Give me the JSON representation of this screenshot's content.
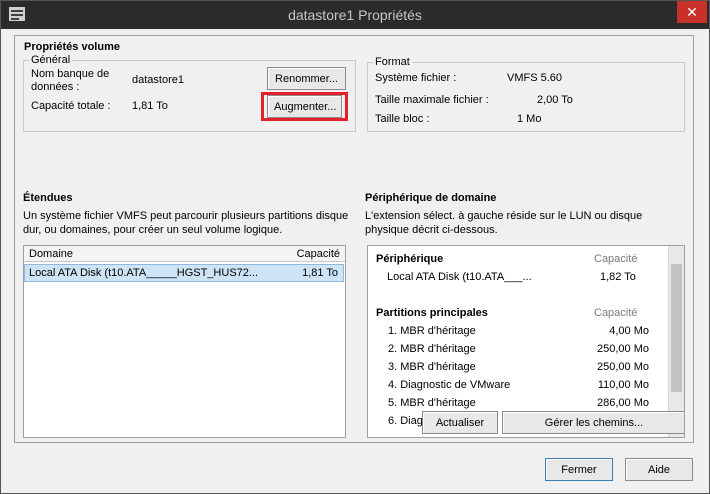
{
  "window": {
    "title": "datastore1 Propriétés",
    "close_glyph": "✕"
  },
  "volume": {
    "heading": "Propriétés volume",
    "general": {
      "legend": "Général",
      "name_label_1": "Nom banque de",
      "name_label_2": "données :",
      "name_value": "datastore1",
      "rename_button": "Renommer...",
      "capacity_label": "Capacité totale :",
      "capacity_value": "1,81 To",
      "increase_button": "Augmenter..."
    },
    "format": {
      "legend": "Format",
      "fs_label": "Système fichier :",
      "fs_value": "VMFS 5.60",
      "max_file_label": "Taille maximale fichier :",
      "max_file_value": "2,00 To",
      "block_label": "Taille bloc :",
      "block_value": "1 Mo"
    }
  },
  "extents": {
    "heading": "Étendues",
    "desc_1": "Un système fichier VMFS peut parcourir plusieurs partitions disque",
    "desc_2": "dur, ou domaines, pour créer un seul volume logique.",
    "col_domain": "Domaine",
    "col_capacity": "Capacité",
    "rows": [
      {
        "domain": "Local ATA Disk (t10.ATA_____HGST_HUS72...",
        "capacity": "1,81 To"
      }
    ]
  },
  "device": {
    "heading": "Périphérique de domaine",
    "desc_1": "L'extension sélect. à gauche réside sur le LUN ou disque",
    "desc_2": "physique décrit ci-dessous.",
    "peripheral_label": "Périphérique",
    "capacity_label": "Capacité",
    "device_name": "Local ATA Disk (t10.ATA___...",
    "device_capacity": "1,82 To",
    "partitions_label": "Partitions principales",
    "partitions_capacity_label": "Capacité",
    "partitions": [
      {
        "name": "1. MBR d'héritage",
        "size": "4,00 Mo"
      },
      {
        "name": "2. MBR d'héritage",
        "size": "250,00 Mo"
      },
      {
        "name": "3. MBR d'héritage",
        "size": "250,00 Mo"
      },
      {
        "name": "4. Diagnostic de VMware",
        "size": "110,00 Mo"
      },
      {
        "name": "5. MBR d'héritage",
        "size": "286,00 Mo"
      },
      {
        "name": "6. Diag",
        "size": ""
      }
    ],
    "refresh_button": "Actualiser",
    "manage_paths_button": "Gérer les chemins..."
  },
  "footer": {
    "close_button": "Fermer",
    "help_button": "Aide"
  },
  "colors": {
    "highlight": "#e3202a",
    "selection": "#cde3f6",
    "titlebar": "#2b2b2b"
  }
}
